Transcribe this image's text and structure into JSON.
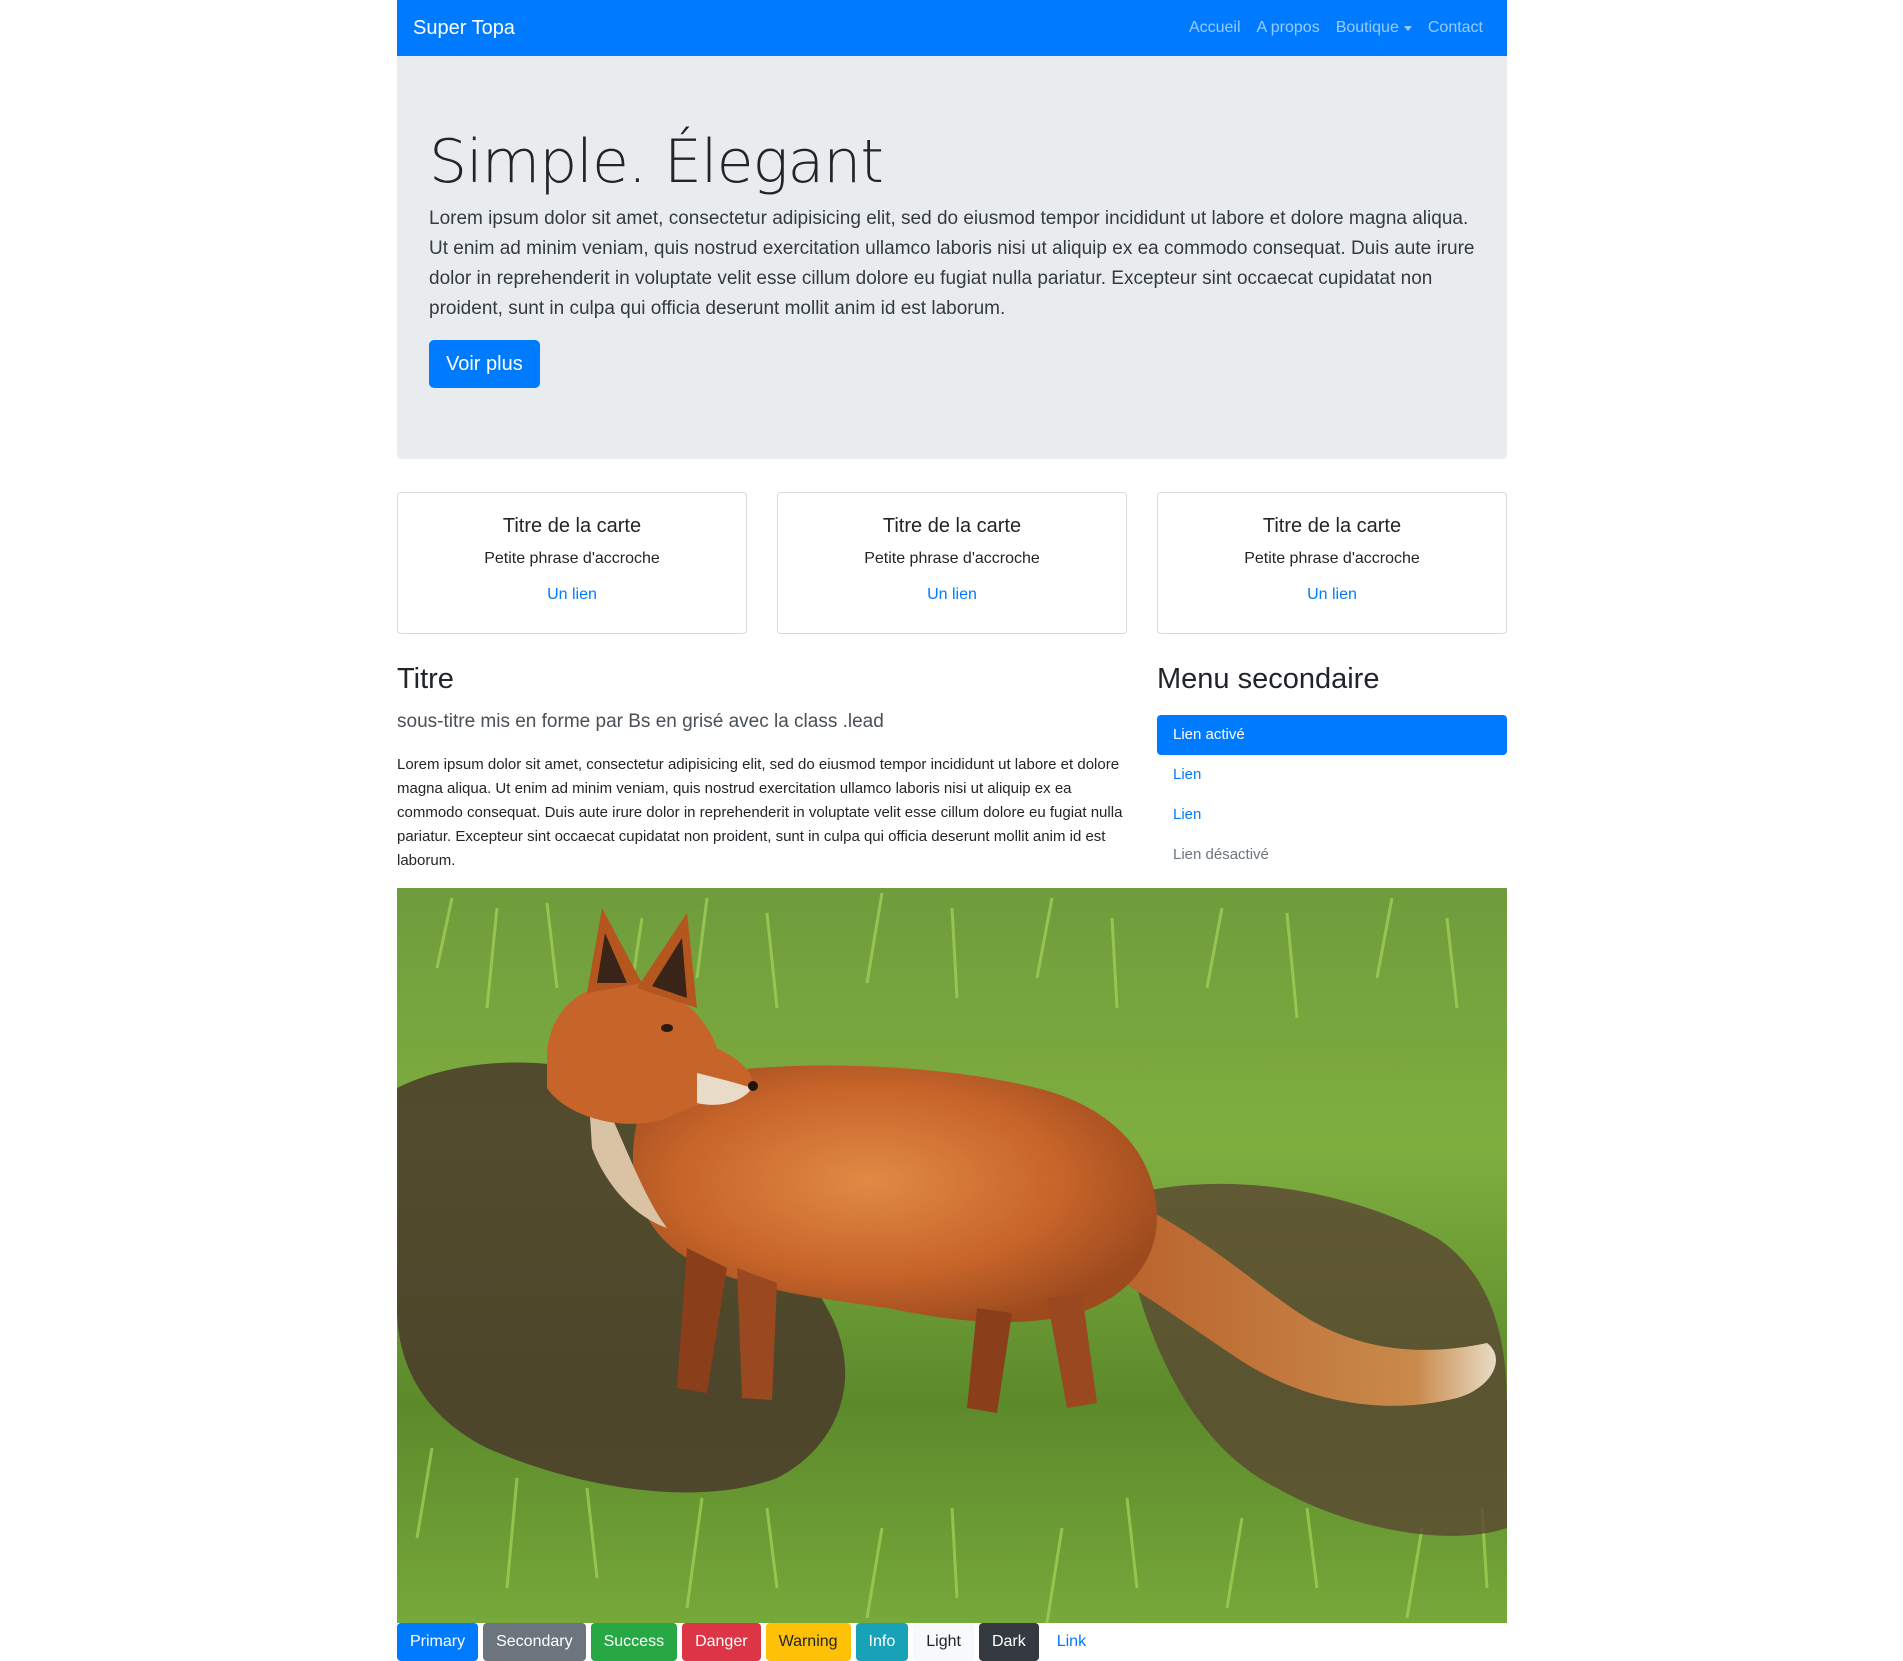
{
  "navbar": {
    "brand": "Super Topa",
    "links": [
      "Accueil",
      "A propos",
      "Boutique",
      "Contact"
    ],
    "color": "#007bff"
  },
  "jumbotron": {
    "title": "Simple. Élegant",
    "text": "Lorem ipsum dolor sit amet, consectetur adipisicing elit, sed do eiusmod tempor incididunt ut labore et dolore magna aliqua. Ut enim ad minim veniam, quis nostrud exercitation ullamco laboris nisi ut aliquip ex ea commodo consequat. Duis aute irure dolor in reprehenderit in voluptate velit esse cillum dolore eu fugiat nulla pariatur. Excepteur sint occaecat cupidatat non proident, sunt in culpa qui officia deserunt mollit anim id est laborum.",
    "button": "Voir plus"
  },
  "cards": [
    {
      "title": "Titre de la carte",
      "text": "Petite phrase d'accroche",
      "link": "Un lien"
    },
    {
      "title": "Titre de la carte",
      "text": "Petite phrase d'accroche",
      "link": "Un lien"
    },
    {
      "title": "Titre de la carte",
      "text": "Petite phrase d'accroche",
      "link": "Un lien"
    }
  ],
  "main": {
    "title": "Titre",
    "lead": "sous-titre mis en forme par Bs en grisé avec la class .lead",
    "text": "Lorem ipsum dolor sit amet, consectetur adipisicing elit, sed do eiusmod tempor incididunt ut labore et dolore magna aliqua. Ut enim ad minim veniam, quis nostrud exercitation ullamco laboris nisi ut aliquip ex ea commodo consequat. Duis aute irure dolor in reprehenderit in voluptate velit esse cillum dolore eu fugiat nulla pariatur. Excepteur sint occaecat cupidatat non proident, sunt in culpa qui officia deserunt mollit anim id est laborum."
  },
  "sidebar": {
    "title": "Menu secondaire",
    "items": [
      {
        "label": "Lien activé",
        "state": "active"
      },
      {
        "label": "Lien",
        "state": "normal"
      },
      {
        "label": "Lien",
        "state": "normal"
      },
      {
        "label": "Lien désactivé",
        "state": "disabled"
      }
    ]
  },
  "image": {
    "icon": "fox-photo"
  },
  "buttons": [
    {
      "label": "Primary",
      "color": "#007bff",
      "text_color": "#ffffff"
    },
    {
      "label": "Secondary",
      "color": "#6c757d",
      "text_color": "#ffffff"
    },
    {
      "label": "Success",
      "color": "#28a745",
      "text_color": "#ffffff"
    },
    {
      "label": "Danger",
      "color": "#dc3545",
      "text_color": "#ffffff"
    },
    {
      "label": "Warning",
      "color": "#ffc107",
      "text_color": "#212529"
    },
    {
      "label": "Info",
      "color": "#17a2b8",
      "text_color": "#ffffff"
    },
    {
      "label": "Light",
      "color": "#f8f9fa",
      "text_color": "#212529"
    },
    {
      "label": "Dark",
      "color": "#343a40",
      "text_color": "#ffffff"
    },
    {
      "label": "Link",
      "color": "transparent",
      "text_color": "#007bff"
    }
  ]
}
